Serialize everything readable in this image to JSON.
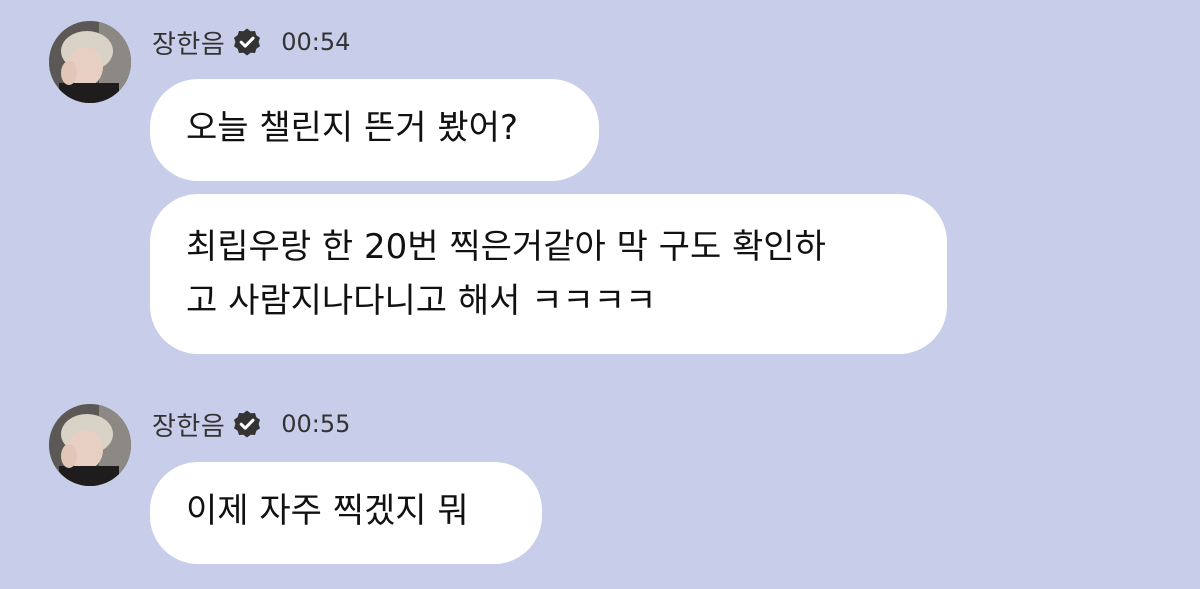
{
  "messages": [
    {
      "sender": "장한음",
      "time": "00:54",
      "avatar_icon": "user-avatar",
      "verified_icon": "verified-badge-icon",
      "bubbles": [
        {
          "lines": [
            "오늘 챌린지 뜬거 봤어?"
          ]
        },
        {
          "lines": [
            "최립우랑 한 20번 찍은거같아 막 구도 확인하",
            "고 사람지나다니고 해서 ㅋㅋㅋㅋ"
          ]
        }
      ]
    },
    {
      "sender": "장한음",
      "time": "00:55",
      "avatar_icon": "user-avatar",
      "verified_icon": "verified-badge-icon",
      "bubbles": [
        {
          "lines": [
            "이제 자주 찍겠지 뭐"
          ]
        }
      ]
    }
  ],
  "colors": {
    "background": "#c8cee9",
    "bubble": "#ffffff",
    "verified_badge": "#333333"
  }
}
